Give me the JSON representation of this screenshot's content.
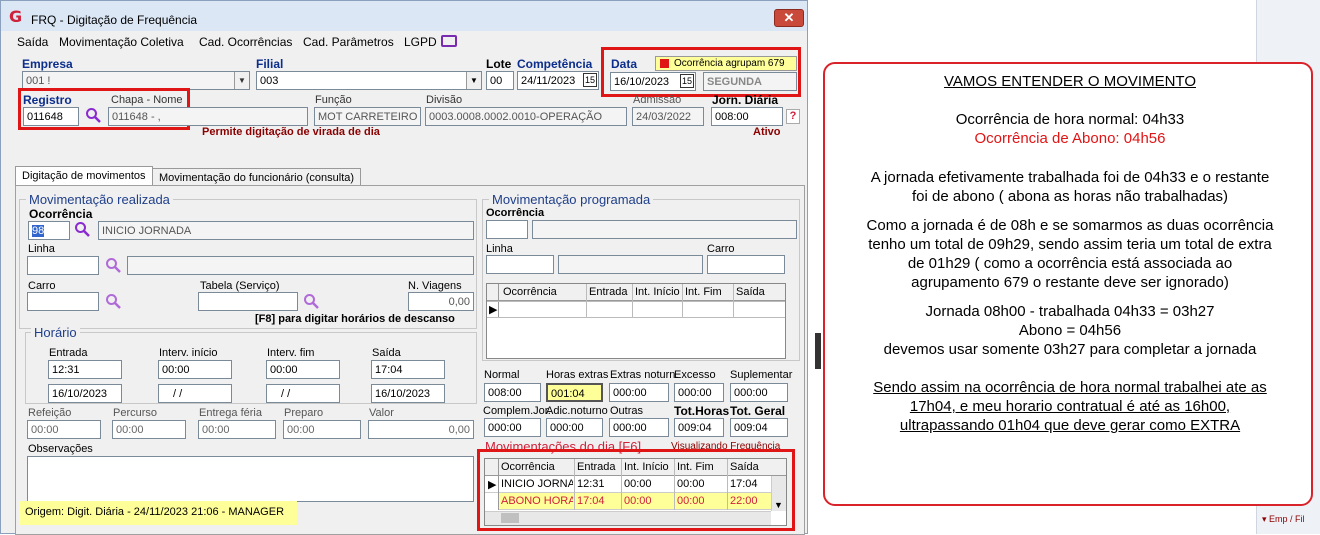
{
  "window": {
    "title": "FRQ - Digitação de Frequência",
    "close": "✕"
  },
  "menu": [
    "Saída",
    "Movimentação Coletiva",
    "Cad. Ocorrências",
    "Cad. Parâmetros",
    "LGPD"
  ],
  "header": {
    "empresa_label": "Empresa",
    "empresa_value": "001 !",
    "filial_label": "Filial",
    "filial_value": "003",
    "lote_label": "Lote",
    "lote_value": "00",
    "competencia_label": "Competência",
    "competencia_value": "24/11/2023",
    "data_label": "Data",
    "data_value": "16/10/2023",
    "ocorr_agrupam": "Ocorrência agrupam 679",
    "weekday": "SEGUNDA",
    "registro_label": "Registro",
    "registro_value": "011648",
    "chapa_label": "Chapa  -  Nome",
    "chapa_value": "011648 - ,",
    "funcao_label": "Função",
    "funcao_value": "MOT CARRETEIRO",
    "divisao_label": "Divisão",
    "divisao_value": "0003.0008.0002.0010-OPERAÇÃO",
    "admissao_label": "Admissão",
    "admissao_value": "24/03/2022",
    "jorn_label": "Jorn. Diária",
    "jorn_value": "008:00",
    "help": "?",
    "virada_msg": "Permite digitação de virada de dia",
    "status": "Ativo"
  },
  "tabs": [
    "Digitação de movimentos",
    "Movimentação do funcionário (consulta)"
  ],
  "realizada": {
    "title": "Movimentação realizada",
    "ocorrencia_label": "Ocorrência",
    "ocorrencia_code": "98",
    "ocorrencia_desc": "INICIO JORNADA",
    "linha_label": "Linha",
    "carro_label": "Carro",
    "tabela_label": "Tabela (Serviço)",
    "nviagens_label": "N. Viagens",
    "nviagens_value": "0,00",
    "f8_hint": "[F8] para digitar horários de descanso"
  },
  "horario": {
    "title": "Horário",
    "entrada_label": "Entrada",
    "entrada_value": "12:31",
    "entrada_date": "16/10/2023",
    "interv_ini_label": "Interv. início",
    "interv_ini_value": "00:00",
    "interv_ini_date": "/ /",
    "interv_fim_label": "Interv. fim",
    "interv_fim_value": "00:00",
    "interv_fim_date": "/ /",
    "saida_label": "Saída",
    "saida_value": "17:04",
    "saida_date": "16/10/2023"
  },
  "extras": {
    "refeicao_label": "Refeição",
    "refeicao_value": "00:00",
    "percurso_label": "Percurso",
    "percurso_value": "00:00",
    "entrega_label": "Entrega féria",
    "entrega_value": "00:00",
    "preparo_label": "Preparo",
    "preparo_value": "00:00",
    "valor_label": "Valor",
    "valor_value": "0,00",
    "obs_label": "Observações",
    "origem": "Origem: Digit. Diária - 24/11/2023 21:06 - MANAGER"
  },
  "programada": {
    "title": "Movimentação programada",
    "ocorrencia_label": "Ocorrência",
    "linha_label": "Linha",
    "carro_label": "Carro",
    "cols": [
      "Ocorrência",
      "Entrada",
      "Int. Início",
      "Int. Fim",
      "Saída"
    ]
  },
  "totals": {
    "normal_label": "Normal",
    "normal_value": "008:00",
    "hextras_label": "Horas extras",
    "hextras_value": "001:04",
    "extnot_label": "Extras noturn.",
    "extnot_value": "000:00",
    "excesso_label": "Excesso",
    "excesso_value": "000:00",
    "suplem_label": "Suplementar",
    "suplem_value": "000:00",
    "complem_label": "Complem.Jor.",
    "complem_value": "000:00",
    "adicnot_label": "Adic.noturno",
    "adicnot_value": "000:00",
    "outras_label": "Outras",
    "outras_value": "000:00",
    "tothoras_label": "Tot.Horas",
    "tothoras_value": "009:04",
    "totgeral_label": "Tot. Geral",
    "totgeral_value": "009:04"
  },
  "dia": {
    "title": "Movimentações do dia  [F6]",
    "visualizando": "Visualizando Frequência",
    "cols": [
      "Ocorrência",
      "Entrada",
      "Int. Início",
      "Int. Fim",
      "Saída"
    ],
    "rows": [
      [
        "INICIO JORNA",
        "12:31",
        "00:00",
        "00:00",
        "17:04"
      ],
      [
        "ABONO HORA",
        "17:04",
        "00:00",
        "00:00",
        "22:00"
      ]
    ]
  },
  "explanation": {
    "heading": "VAMOS ENTENDER O MOVIMENTO",
    "l1": "Ocorrência de hora normal: 04h33",
    "l2": "Ocorrência de Abono: 04h56",
    "l3": "A jornada efetivamente trabalhada foi de 04h33 e o restante",
    "l4": "foi de abono ( abona as horas não trabalhadas)",
    "l5": "Como a jornada é de 08h e se somarmos as duas ocorrência",
    "l6": "tenho um total de 09h29, sendo assim teria um total de extra",
    "l7": "de 01h29 ( como a ocorrência está associada ao",
    "l8": "agrupamento 679 o restante deve ser ignorado)",
    "l9": "Jornada 08h00 - trabalhada 04h33 = 03h27",
    "l10": "Abono = 04h56",
    "l11": "devemos usar somente 03h27 para completar a jornada",
    "l12": "Sendo assim na ocorrência de hora normal trabalhei ate as",
    "l13": "17h04, e meu horario contratual é até as 16h00,",
    "l14": "ultrapassando 01h04 que deve gerar como EXTRA"
  },
  "sidebar_right": {
    "bottom": "Emp / Fil"
  },
  "colors": {
    "red": "#e01515",
    "highlight": "#ffff99",
    "accent": "#0b2d8c"
  }
}
